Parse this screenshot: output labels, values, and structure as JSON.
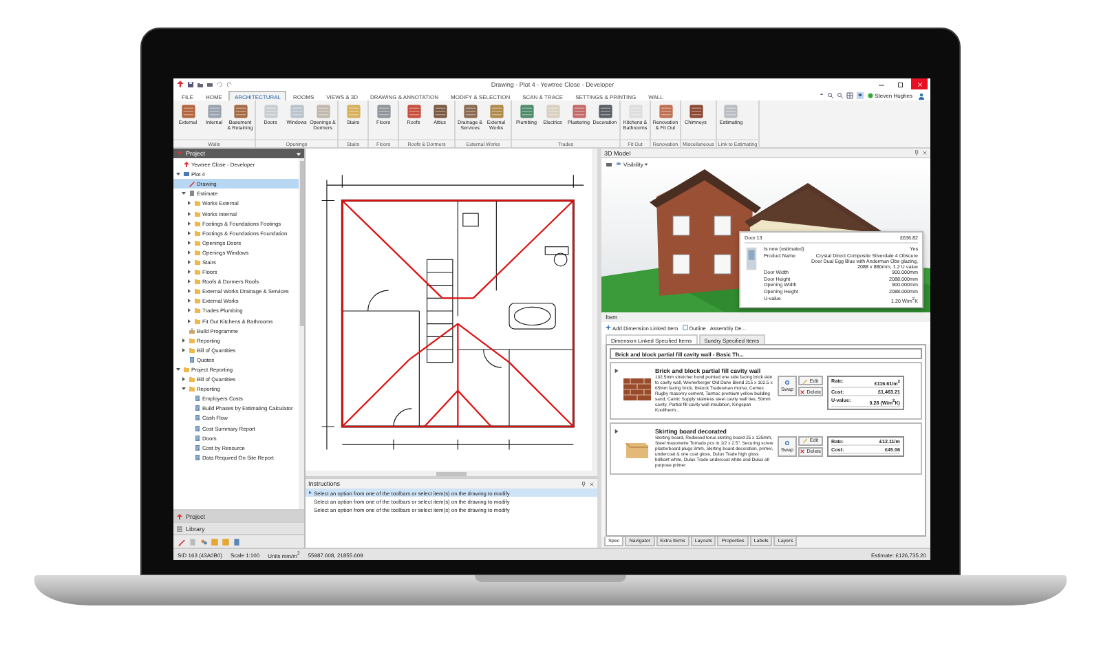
{
  "window": {
    "title": "Drawing - Plot 4 - Yewtree Close - Developer"
  },
  "ribbon": {
    "tabs": [
      {
        "label": "FILE",
        "selected": false
      },
      {
        "label": "HOME",
        "selected": false
      },
      {
        "label": "ARCHITECTURAL",
        "selected": true
      },
      {
        "label": "ROOMS",
        "selected": false
      },
      {
        "label": "VIEWS & 3D",
        "selected": false
      },
      {
        "label": "DRAWING & ANNOTATION",
        "selected": false
      },
      {
        "label": "MODIFY & SELECTION",
        "selected": false
      },
      {
        "label": "SCAN & TRACE",
        "selected": false
      },
      {
        "label": "SETTINGS & PRINTING",
        "selected": false
      },
      {
        "label": "WALL",
        "selected": false
      }
    ],
    "user": "Steven Hughes",
    "groups": [
      {
        "label": "Walls",
        "buttons": [
          "External",
          "Internal",
          "Basement & Retaining"
        ]
      },
      {
        "label": "Openings",
        "buttons": [
          "Doors",
          "Windows",
          "Openings & Dormers"
        ]
      },
      {
        "label": "Stairs",
        "buttons": [
          "Stairs"
        ]
      },
      {
        "label": "Floors",
        "buttons": [
          "Floors"
        ]
      },
      {
        "label": "Roofs & Dormers",
        "buttons": [
          "Roofs",
          "Attics"
        ]
      },
      {
        "label": "External Works",
        "buttons": [
          "Drainage & Services",
          "External Works"
        ]
      },
      {
        "label": "Trades",
        "buttons": [
          "Plumbing",
          "Electrics",
          "Plastering",
          "Decoration"
        ]
      },
      {
        "label": "Fit Out",
        "buttons": [
          "Kitchens & Bathrooms"
        ]
      },
      {
        "label": "Renovation",
        "buttons": [
          "Renovation & Fit Out"
        ]
      },
      {
        "label": "Miscellaneous",
        "buttons": [
          "Chimneys"
        ]
      },
      {
        "label": "Link to Estimating",
        "buttons": [
          "Estimating"
        ]
      }
    ]
  },
  "project": {
    "title": "Project",
    "tree": [
      {
        "label": "Yewtree Close - Developer",
        "kind": "project",
        "selected": false
      },
      {
        "label": "Plot 4",
        "kind": "plot",
        "selected": false,
        "expanded": true,
        "children": [
          {
            "label": "Drawing",
            "kind": "drawing",
            "selected": true
          },
          {
            "label": "Estimate",
            "kind": "estimate",
            "selected": false,
            "expanded": true,
            "children": [
              {
                "label": "Works External",
                "kind": "folder",
                "selected": false,
                "expanded": false
              },
              {
                "label": "Works Internal",
                "kind": "folder",
                "selected": false,
                "expanded": false
              },
              {
                "label": "Footings & Foundations Footings",
                "kind": "folder",
                "selected": false,
                "expanded": false
              },
              {
                "label": "Footings & Foundations Foundation",
                "kind": "folder",
                "selected": false,
                "expanded": false
              },
              {
                "label": "Openings Doors",
                "kind": "folder",
                "selected": false,
                "expanded": false
              },
              {
                "label": "Openings Windows",
                "kind": "folder",
                "selected": false,
                "expanded": false
              },
              {
                "label": "Stairs",
                "kind": "folder",
                "selected": false,
                "expanded": false
              },
              {
                "label": "Floors",
                "kind": "folder",
                "selected": false,
                "expanded": false
              },
              {
                "label": "Roofs & Dormers Roofs",
                "kind": "folder",
                "selected": false,
                "expanded": false
              },
              {
                "label": "External Works Drainage & Services",
                "kind": "folder",
                "selected": false,
                "expanded": false
              },
              {
                "label": "External Works",
                "kind": "folder",
                "selected": false,
                "expanded": false
              },
              {
                "label": "Trades Plumbing",
                "kind": "folder",
                "selected": false,
                "expanded": false
              },
              {
                "label": "Fit Out Kitchens & Bathrooms",
                "kind": "folder",
                "selected": false,
                "expanded": false
              }
            ]
          },
          {
            "label": "Build Programme",
            "kind": "programme",
            "selected": false
          },
          {
            "label": "Reporting",
            "kind": "folder",
            "selected": false,
            "expanded": false
          },
          {
            "label": "Bill of Quantities",
            "kind": "folder",
            "selected": false,
            "expanded": false
          },
          {
            "label": "Quotes",
            "kind": "report",
            "selected": false
          }
        ]
      },
      {
        "label": "Project Reporting",
        "kind": "folder",
        "selected": false,
        "expanded": true,
        "children": [
          {
            "label": "Bill of Quantities",
            "kind": "folder",
            "selected": false,
            "expanded": false
          },
          {
            "label": "Reporting",
            "kind": "folder",
            "selected": false,
            "expanded": true,
            "children": [
              {
                "label": "Employers Costs",
                "kind": "report",
                "selected": false
              },
              {
                "label": "Build Phases by Estimating Calculator",
                "kind": "report",
                "selected": false
              },
              {
                "label": "Cash Flow",
                "kind": "report",
                "selected": false
              },
              {
                "label": "Cost Summary Report",
                "kind": "report",
                "selected": false
              },
              {
                "label": "Doors",
                "kind": "report",
                "selected": false
              },
              {
                "label": "Cost by Resource",
                "kind": "report",
                "selected": false
              },
              {
                "label": "Data Required On Site Report",
                "kind": "report",
                "selected": false
              }
            ]
          }
        ]
      }
    ],
    "tabs": [
      {
        "label": "Project",
        "selected": true
      },
      {
        "label": "Library",
        "selected": false
      }
    ]
  },
  "instructions": {
    "title": "Instructions",
    "lines": [
      {
        "text": "Select an option from one of the toolbars or select item(s) on the drawing to modify",
        "selected": true
      },
      {
        "text": "Select an option from one of the toolbars or select item(s) on the drawing to modify",
        "selected": false
      },
      {
        "text": "Select an option from one of the toolbars or select item(s) on the drawing to modify",
        "selected": false
      }
    ]
  },
  "model": {
    "title": "3D Model",
    "visibility": "Visibility",
    "tooltip": {
      "title": "Door 13",
      "price": "£636.82",
      "rows": [
        {
          "label": "Is new (estimated)",
          "value": "Yes"
        },
        {
          "label": "Product Name",
          "value": "Crystal Direct Composite Silverdale 4 Obscure Door Dual Egg Blue with Anderman Obs glazing, 2088 x 880mm, 1.2 U value"
        },
        {
          "label": "Door Width",
          "value": "900.000mm"
        },
        {
          "label": "Door Height",
          "value": "2088.000mm"
        },
        {
          "label": "Opening Width",
          "value": "900.000mm"
        },
        {
          "label": "Opening Height",
          "value": "2088.000mm"
        },
        {
          "label": "U-value",
          "value": "1.20 W/m$^{2}$K"
        }
      ]
    }
  },
  "items": {
    "title": "Item",
    "toolbar": [
      "Add Dimension Linked Item",
      "Outline",
      "Assembly De..."
    ],
    "tabs": [
      {
        "label": "Dimension Linked Specified Items",
        "selected": true
      },
      {
        "label": "Sundry Specified Items",
        "selected": false
      }
    ],
    "group": "Brick and block partial fill cavity wall - Basic Th...",
    "cards": [
      {
        "kind": "brick",
        "name": "Brick and block partial fill cavity wall",
        "description": "102.5mm stretcher bond pointed one side facing brick skin to cavity wall, Wienerberger Old Dane Blend 215 x 102.5 x 65mm facing brick, Ibstock Tradesman mortar, Cemex Rugby masonry cement, Tarmac premium yellow building sand, Catnic Supply stainless steel cavity wall ties, 50mm cavity, Partial fill cavity wall insulation, Kingspan Kooltherm...",
        "actions": [
          "Swap",
          "Edit",
          "Delete"
        ],
        "figures": [
          {
            "label": "Rate:",
            "value": "£116.61/m$^{2}$"
          },
          {
            "label": "Cost:",
            "value": "£1,463.21"
          },
          {
            "label": "U-value:",
            "value": "0.28 (W/m$^{2}$K)"
          }
        ]
      },
      {
        "kind": "timber",
        "name": "Skirting board decorated",
        "description": "Skirting board, Redwood torus skirting board 25 x 125mm, Steel masonwire Tornado pcs in 1/2 x 2.5\", Securing screw plasterboard plugs 8mm, Skirting board decoration, primer, undercoat & one coat gloss, Dulux Trade high gloss brilliant white, Dulux Trade undercoat white and Dulux all purpose primer",
        "actions": [
          "Swap",
          "Edit",
          "Delete"
        ],
        "figures": [
          {
            "label": "Rate:",
            "value": "£12.11/m"
          },
          {
            "label": "Cost:",
            "value": "£45.06"
          }
        ]
      }
    ],
    "bottom_tabs": [
      {
        "label": "Spec",
        "selected": true
      },
      {
        "label": "Navigator",
        "selected": false
      },
      {
        "label": "Extra Items",
        "selected": false
      },
      {
        "label": "Layouts",
        "selected": false
      },
      {
        "label": "Properties",
        "selected": false
      },
      {
        "label": "Labels",
        "selected": false
      },
      {
        "label": "Layers",
        "selected": false
      }
    ]
  },
  "status_bar": {
    "left": [
      "SID 163 (43A0B0)",
      "Scale 1:100",
      "Units mm/m$^{2}$",
      "55987.608, 21855.609"
    ],
    "right": "Estimate: £126,735.20"
  }
}
